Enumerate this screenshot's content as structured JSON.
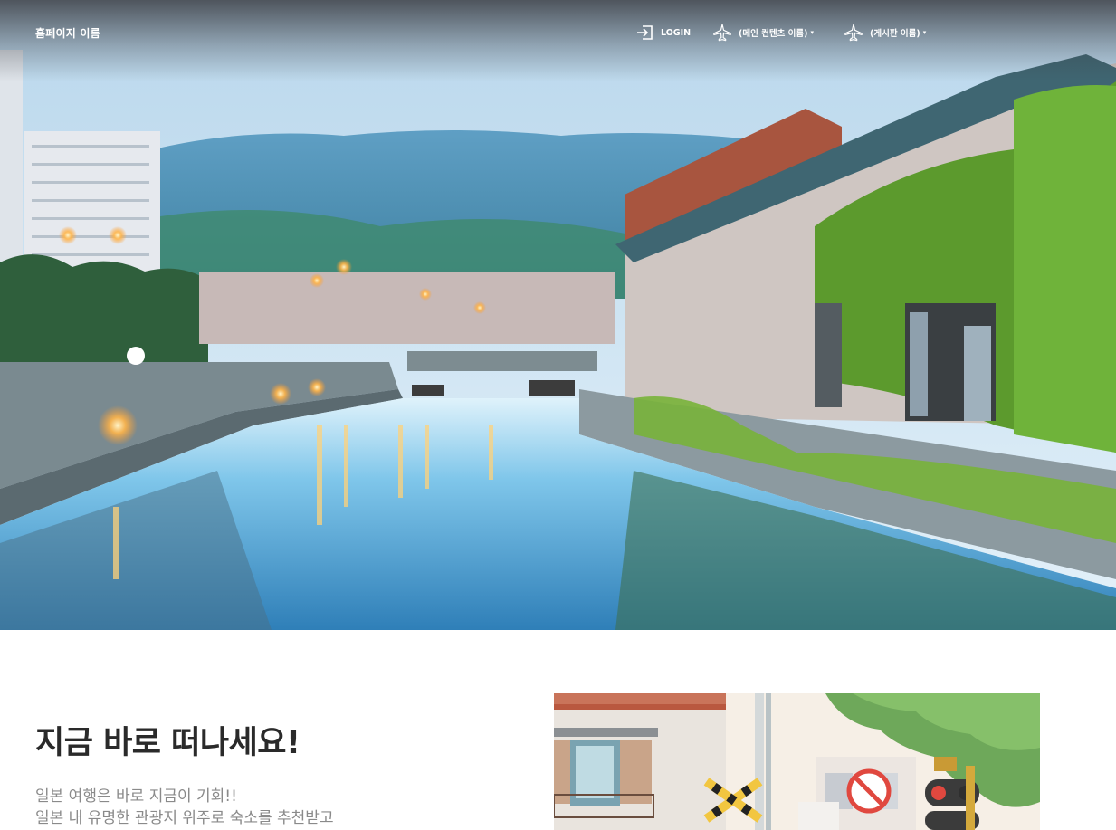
{
  "header": {
    "brand": "홈페이지 이름",
    "nav": {
      "login": {
        "label": "LOGIN",
        "icon": "login-icon"
      },
      "main_contents": {
        "label": "(메인 컨텐츠 이름)",
        "icon": "airplane-icon",
        "caret": "▾"
      },
      "board": {
        "label": "(게시판 이름)",
        "icon": "airplane-icon",
        "caret": "▾"
      }
    }
  },
  "hero": {
    "image": "otaru-canal-photo"
  },
  "intro": {
    "title": "지금 바로 떠나세요!",
    "lines": [
      "일본 여행은 바로 지금이 기회!!",
      "일본 내 유명한 관광지 위주로 숙소를 추천받고"
    ],
    "image": "japanese-street-illustration"
  },
  "colors": {
    "nav_text": "#ffffff",
    "title": "#2a2a2a",
    "body_text": "#8a8a8a"
  }
}
